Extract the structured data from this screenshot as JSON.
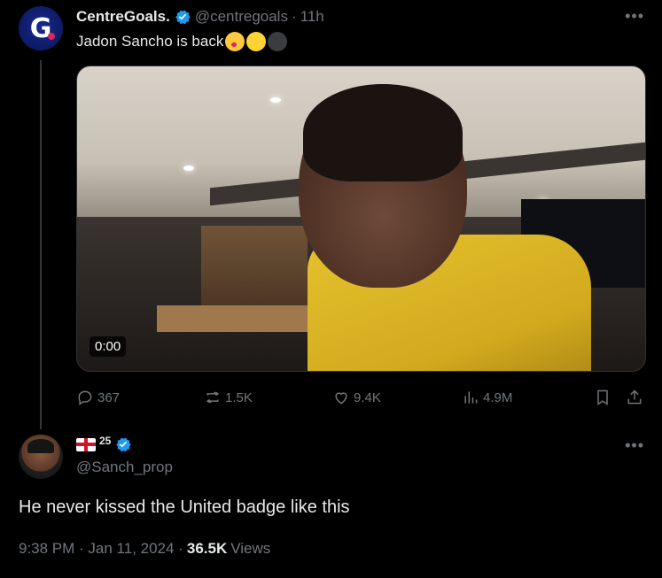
{
  "parent_tweet": {
    "avatar_letter": "G",
    "display_name": "CentreGoals.",
    "handle": "@centregoals",
    "separator": "·",
    "time_ago": "11h",
    "text": "Jadon Sancho is back",
    "emojis": [
      "kissing-face-emoji",
      "yellow-circle-emoji",
      "black-circle-emoji"
    ],
    "video_time": "0:00",
    "actions": {
      "replies": "367",
      "retweets": "1.5K",
      "likes": "9.4K",
      "views": "4.9M"
    }
  },
  "reply_tweet": {
    "display_suffix": "25",
    "handle": "@Sanch_prop",
    "text": "He never kissed the United badge like this",
    "timestamp": "9:38 PM · Jan 11, 2024 ·",
    "views_count": "36.5K",
    "views_label": "Views"
  },
  "colors": {
    "background": "#000000",
    "text_primary": "#e7e9ea",
    "text_secondary": "#71767b",
    "verified": "#1d9bf0"
  }
}
